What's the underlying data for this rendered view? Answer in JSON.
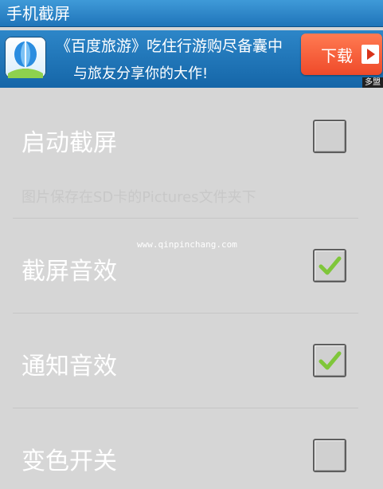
{
  "app": {
    "title": "手机截屏"
  },
  "ad": {
    "line1": "《百度旅游》吃住行游购尽备囊中",
    "line2": "与旅友分享你的大作!",
    "download_label": "下载",
    "badge": "多盟"
  },
  "settings": [
    {
      "label": "启动截屏",
      "checked": false,
      "icon": "checkbox-empty"
    },
    {
      "label": "截屏音效",
      "checked": true,
      "icon": "check-icon"
    },
    {
      "label": "通知音效",
      "checked": true,
      "icon": "check-icon"
    },
    {
      "label": "变色开关",
      "checked": false,
      "icon": "checkbox-empty"
    }
  ],
  "hint": "图片保存在SD卡的Pictures文件夹下",
  "watermark": "www.qinpinchang.com",
  "colors": {
    "titlebar": "#1f74b9",
    "check": "#7fc63a",
    "background": "#d6d6d6",
    "download": "#ef4a2a"
  }
}
